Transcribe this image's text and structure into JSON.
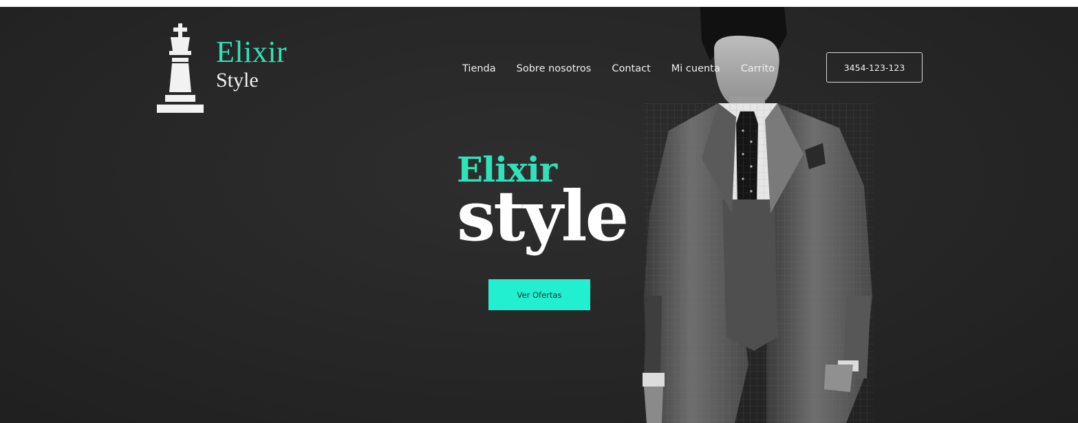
{
  "brand": {
    "logo_line1": "Elixir",
    "logo_line2": "Style",
    "icon": "chess-king-icon",
    "accent_color": "#2fe3b8"
  },
  "nav": {
    "items": [
      {
        "label": "Tienda"
      },
      {
        "label": "Sobre nosotros"
      },
      {
        "label": "Contact"
      },
      {
        "label": "Mi cuenta"
      },
      {
        "label": "Carrito"
      }
    ],
    "phone": "3454-123-123"
  },
  "hero": {
    "headline_line1": "Elixir",
    "headline_line2": "style",
    "cta_label": "Ver Ofertas",
    "cta_color": "#21efd0",
    "background_color": "#262626"
  }
}
